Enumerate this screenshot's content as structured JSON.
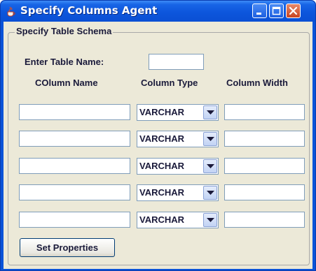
{
  "window": {
    "title": "Specify Columns Agent",
    "controls": [
      "minimize",
      "maximize",
      "close"
    ]
  },
  "group": {
    "title": "Specify Table Schema"
  },
  "table_name": {
    "label": "Enter Table Name:",
    "value": ""
  },
  "columns": {
    "headers": [
      "COlumn Name",
      "Column Type",
      "Column Width"
    ],
    "rows": [
      {
        "name": "",
        "type": "VARCHAR",
        "width": ""
      },
      {
        "name": "",
        "type": "VARCHAR",
        "width": ""
      },
      {
        "name": "",
        "type": "VARCHAR",
        "width": ""
      },
      {
        "name": "",
        "type": "VARCHAR",
        "width": ""
      },
      {
        "name": "",
        "type": "VARCHAR",
        "width": ""
      }
    ]
  },
  "buttons": {
    "set_properties": "Set Properties"
  },
  "colors": {
    "titlebar": "#0a53d8",
    "panel": "#ece9d8",
    "field_border": "#7f9db9",
    "label_text": "#1a1a3a"
  },
  "icons": {
    "app": "java-cup-icon",
    "combo_arrow": "chevron-down-icon"
  }
}
